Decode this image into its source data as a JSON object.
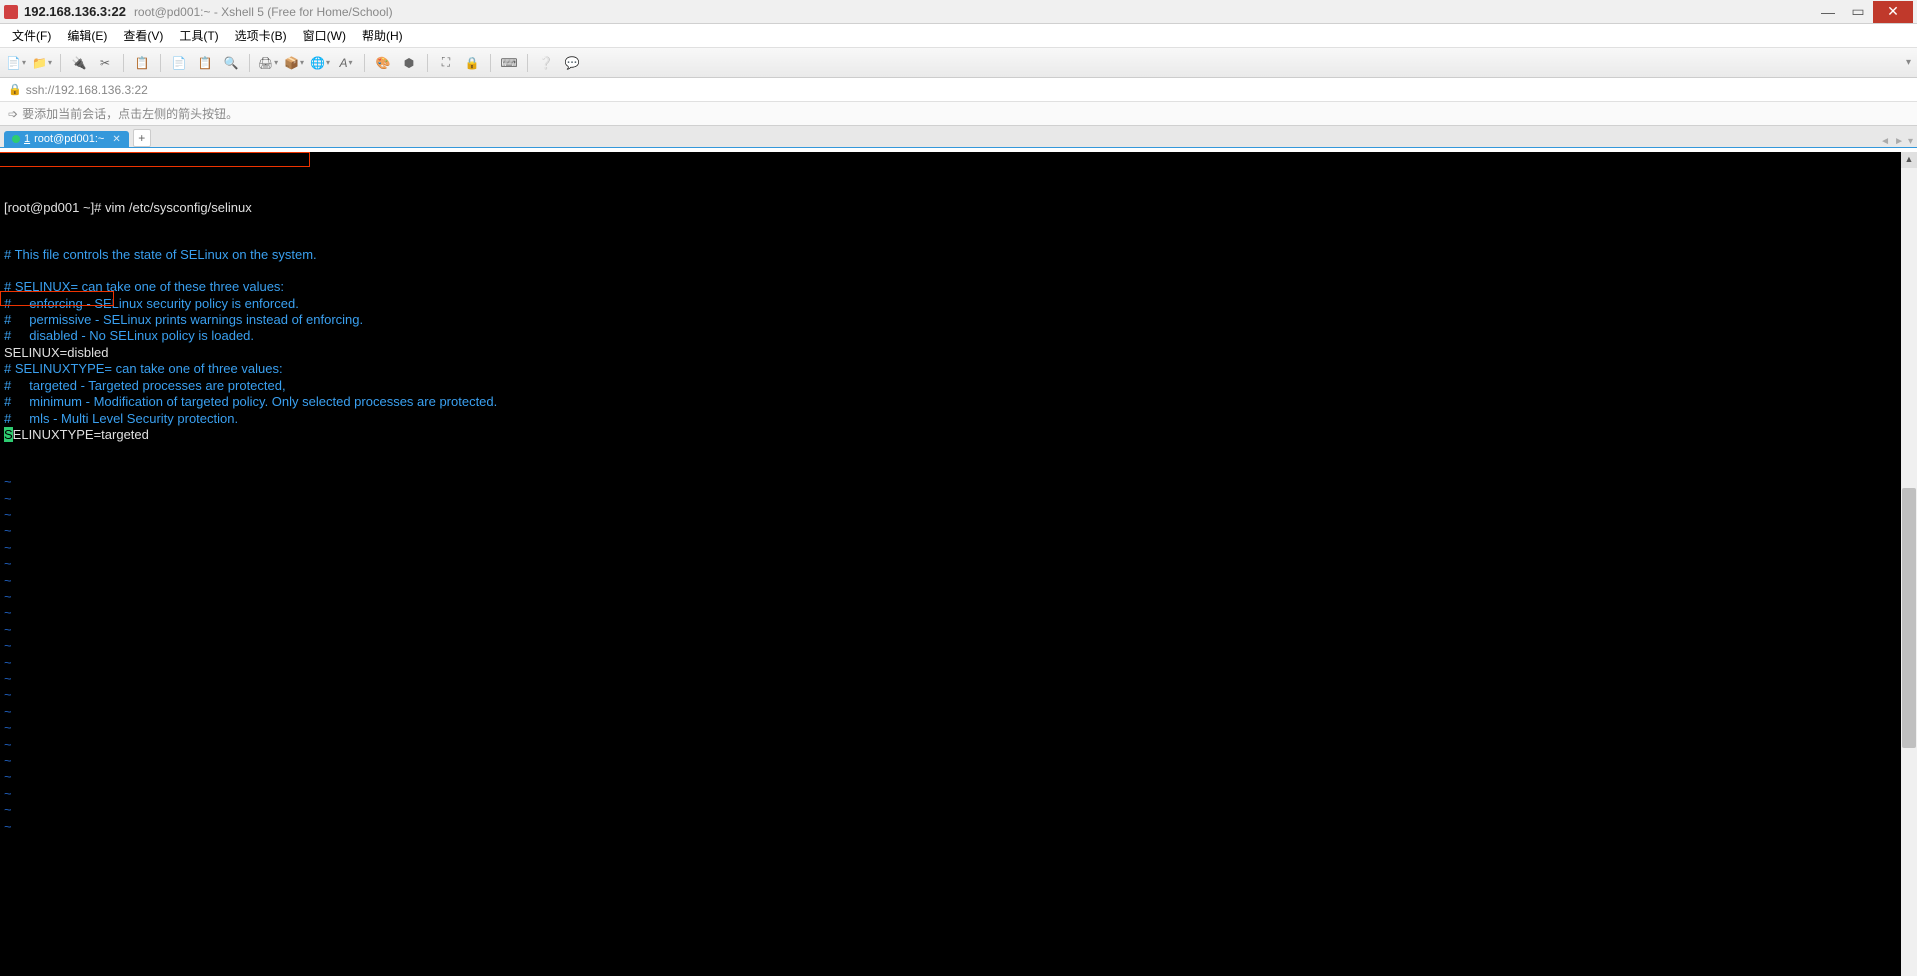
{
  "title": {
    "ip": "192.168.136.3:22",
    "rest": "root@pd001:~ - Xshell 5 (Free for Home/School)"
  },
  "menu": {
    "file": "文件(F)",
    "edit": "编辑(E)",
    "view": "查看(V)",
    "tools": "工具(T)",
    "tabs": "选项卡(B)",
    "window": "窗口(W)",
    "help": "帮助(H)"
  },
  "address": {
    "url": "ssh://192.168.136.3:22"
  },
  "hint": {
    "text": "要添加当前会话，点击左侧的箭头按钮。"
  },
  "tab": {
    "index": "1",
    "label": "root@pd001:~"
  },
  "term": {
    "prompt": "[root@pd001 ~]# ",
    "cmd": "vim /etc/sysconfig/selinux",
    "c1": "# This file controls the state of SELinux on the system.",
    "c2": "# SELINUX= can take one of these three values:",
    "c3": "#     enforcing - SELinux security policy is enforced.",
    "c4": "#     permissive - SELinux prints warnings instead of enforcing.",
    "c5": "#     disabled - No SELinux policy is loaded.",
    "l_sel": "SELINUX=disbled",
    "c6": "# SELINUXTYPE= can take one of three values:",
    "c7": "#     targeted - Targeted processes are protected,",
    "c8": "#     minimum - Modification of targeted policy. Only selected processes are protected.",
    "c9": "#     mls - Multi Level Security protection.",
    "l_type_first": "S",
    "l_type_rest": "ELINUXTYPE=targeted",
    "tilde": "~"
  }
}
